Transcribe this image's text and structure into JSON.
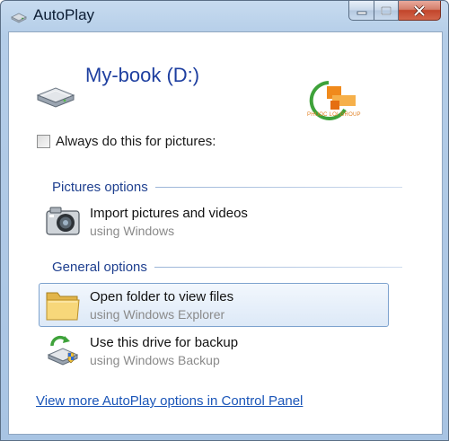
{
  "window": {
    "title": "AutoPlay",
    "controls": {
      "minimize": "minimize",
      "maximize": "maximize",
      "close": "close"
    }
  },
  "drive": {
    "title": "My-book (D:)",
    "icon": "drive-icon"
  },
  "logo": {
    "text": "PHUOC LOI GROUP",
    "colors": {
      "orange": "#f08a1c",
      "green": "#3ea23a"
    }
  },
  "always_checkbox": {
    "label": "Always do this for pictures:",
    "checked": false
  },
  "sections": [
    {
      "title": "Pictures options",
      "options": [
        {
          "title": "Import pictures and videos",
          "subtitle": "using Windows",
          "icon": "camera-icon",
          "selected": false
        }
      ]
    },
    {
      "title": "General options",
      "options": [
        {
          "title": "Open folder to view files",
          "subtitle": "using Windows Explorer",
          "icon": "folder-icon",
          "selected": true
        },
        {
          "title": "Use this drive for backup",
          "subtitle": "using Windows Backup",
          "icon": "backup-icon",
          "selected": false
        }
      ]
    }
  ],
  "footer": {
    "link": "View more AutoPlay options in Control Panel"
  },
  "colors": {
    "heading": "#1e3f8f",
    "link": "#1a55b8",
    "selection_border": "#7da2ce"
  }
}
